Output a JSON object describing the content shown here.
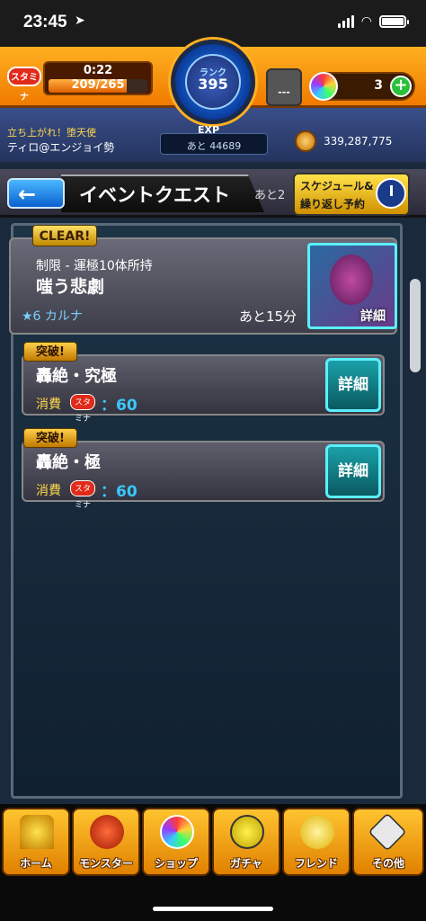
{
  "status_bar": {
    "time": "23:45",
    "location_arrow": "location-arrow-icon"
  },
  "hud": {
    "stamina_label": "スタミナ",
    "stamina_timer": "0:22",
    "stamina_count": "209/265",
    "stamina_fraction": 0.79,
    "rank_label": "ランク",
    "rank_value": "395",
    "exp_label": "EXP",
    "exp_remaining": "あと 44689",
    "helper_label": "---",
    "orb_count": "3",
    "orb_plus": "+"
  },
  "info": {
    "notice": "立ち上がれ！堕天使",
    "player_name": "ティロ@エンジョイ勢",
    "coins": "339,287,775"
  },
  "header": {
    "back_arrow": "←",
    "title": "イベントクエスト",
    "remain_short": "あと2",
    "schedule_line1": "スケジュール&",
    "schedule_line2": "繰り返し予約"
  },
  "main_quest": {
    "clear_badge": "CLEAR!",
    "limit": "制限 - 運極10体所持",
    "name": "嗤う悲劇",
    "stars": "★6 カルナ",
    "remaining": "あと15分",
    "detail_label": "詳細"
  },
  "sub_quests": [
    {
      "badge": "突破!",
      "title": "轟絶・究極",
      "cost_label": "消費",
      "cost_value": "：60",
      "detail_label": "詳細"
    },
    {
      "badge": "突破!",
      "title": "轟絶・極",
      "cost_label": "消費",
      "cost_value": "：60",
      "detail_label": "詳細"
    }
  ],
  "stamina_mini": "スタミナ",
  "nav": [
    {
      "label": "ホーム",
      "icon": "home-icon"
    },
    {
      "label": "モンスター",
      "icon": "monster-icon"
    },
    {
      "label": "ショップ",
      "icon": "shop-icon"
    },
    {
      "label": "ガチャ",
      "icon": "gacha-icon"
    },
    {
      "label": "フレンド",
      "icon": "friend-icon"
    },
    {
      "label": "その他",
      "icon": "other-icon"
    }
  ]
}
